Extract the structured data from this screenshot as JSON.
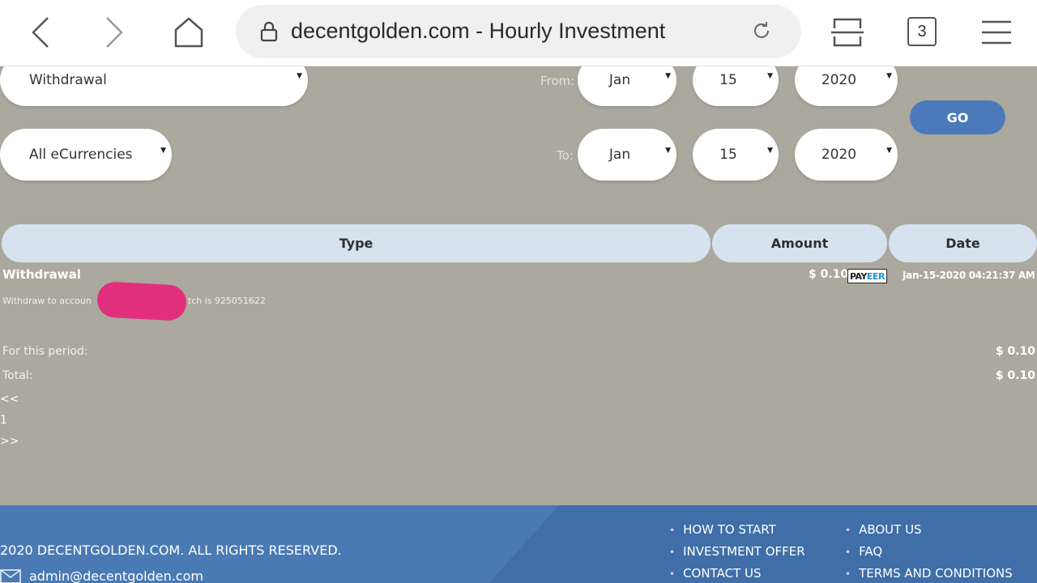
{
  "browser": {
    "url_text": "decentgolden.com - Hourly Investment",
    "tab_count": "3",
    "icons": [
      "back-icon",
      "forward-icon",
      "home-icon",
      "lock-icon",
      "reload-icon",
      "reader-icon",
      "tabs-icon",
      "menu-icon"
    ]
  },
  "filters": {
    "type_select": "Withdrawal",
    "currency_select": "All eCurrencies",
    "from_label": "From:",
    "to_label": "To:",
    "from": {
      "month": "Jan",
      "day": "15",
      "year": "2020"
    },
    "to": {
      "month": "Jan",
      "day": "15",
      "year": "2020"
    },
    "go_label": "GO"
  },
  "table": {
    "headers": [
      "Type",
      "Amount",
      "Date"
    ],
    "rows": [
      {
        "type": "Withdrawal",
        "description_start": "Withdraw to accoun",
        "description_end": "tch is 925051622",
        "amount": "$ 0.10",
        "processor_logo_text": [
          "PAY",
          "EER"
        ],
        "date": "Jan-15-2020 04:21:37 AM"
      }
    ]
  },
  "summary": {
    "period_label": "For this period:",
    "period_value": "$ 0.10",
    "total_label": "Total:",
    "total_value": "$ 0.10"
  },
  "pagination": {
    "prev": "<<",
    "page": "1",
    "next": ">>"
  },
  "footer": {
    "copyright": "2020 DECENTGOLDEN.COM. ALL RIGHTS RESERVED.",
    "email": "admin@decentgolden.com",
    "links_col1": [
      "HOW TO START",
      "INVESTMENT OFFER",
      "CONTACT US"
    ],
    "links_col2": [
      "ABOUT US",
      "FAQ",
      "TERMS AND CONDITIONS"
    ]
  },
  "colors": {
    "page_bg": "#aba89d",
    "accent_button": "#4a7aba",
    "table_header": "#d6e3ef",
    "footer": "#4a7ab4",
    "redaction": "#e22f7d"
  }
}
